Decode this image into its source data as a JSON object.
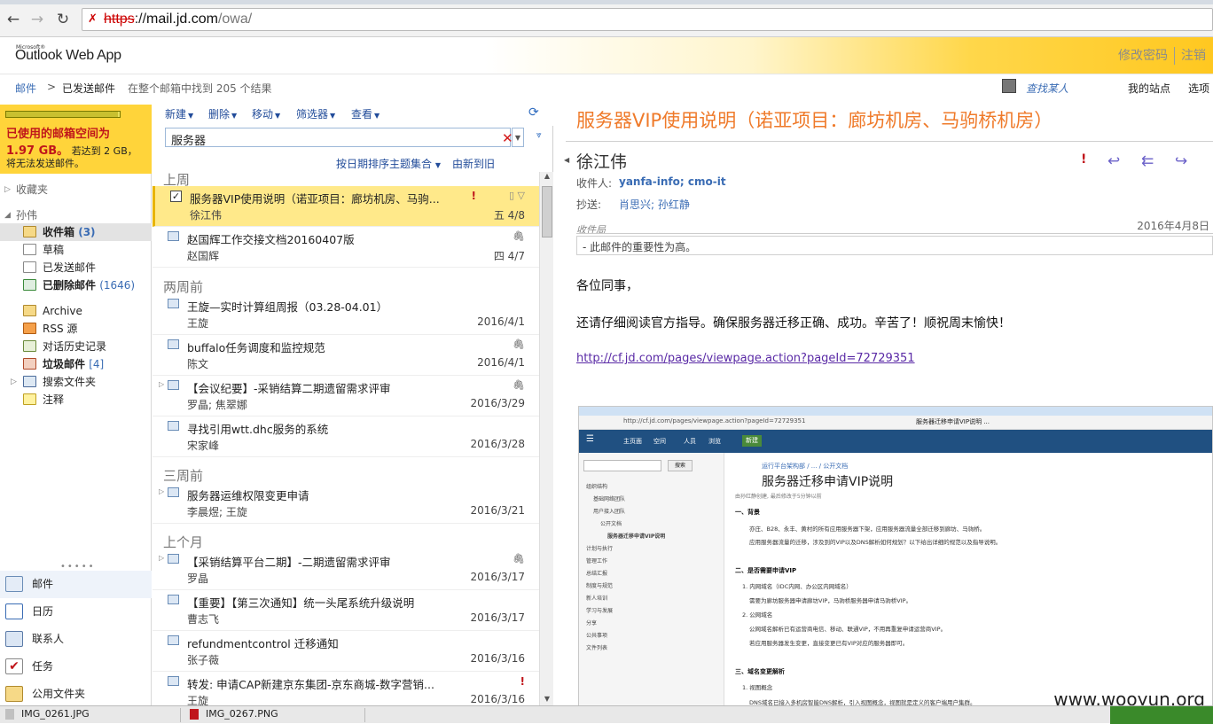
{
  "browser": {
    "url_scheme": "https",
    "url_host": "mail.jd.com",
    "url_path": "/owa/"
  },
  "header": {
    "logo_small": "Microsoft®",
    "logo": "Outlook Web App",
    "change_password": "修改密码",
    "logout": "注销"
  },
  "breadcrumb": {
    "mail": "邮件",
    "arrow": ">",
    "folder": "已发送邮件",
    "search_result": "在整个邮箱中找到 205 个结果",
    "find_people": "查找某人",
    "my_sites": "我的站点",
    "options": "选项"
  },
  "quota": {
    "line1": "已使用的邮箱空间为",
    "used": "1.97 GB。",
    "line2_rest": "若达到 2 GB，",
    "line3": "将无法发送邮件。",
    "fill": 0.985
  },
  "nav": {
    "favorites": "收藏夹",
    "user": "孙伟",
    "folders": [
      {
        "label": "收件箱",
        "count": "(3)"
      },
      {
        "label": "草稿",
        "count": ""
      },
      {
        "label": "已发送邮件",
        "count": ""
      },
      {
        "label": "已删除邮件",
        "count": "(1646)"
      },
      {
        "label": "Archive",
        "count": ""
      },
      {
        "label": "RSS 源",
        "count": ""
      },
      {
        "label": "对话历史记录",
        "count": ""
      },
      {
        "label": "垃圾邮件",
        "count": "[4]"
      },
      {
        "label": "搜索文件夹",
        "count": ""
      },
      {
        "label": "注释",
        "count": ""
      }
    ],
    "grip": "•••••",
    "modules": [
      {
        "label": "邮件",
        "icon": "mail-icon"
      },
      {
        "label": "日历",
        "icon": "calendar-icon"
      },
      {
        "label": "联系人",
        "icon": "contacts-icon"
      },
      {
        "label": "任务",
        "icon": "tasks-icon"
      },
      {
        "label": "公用文件夹",
        "icon": "public-folder-icon"
      }
    ]
  },
  "toolbar": {
    "new": "新建",
    "delete": "删除",
    "move": "移动",
    "filter": "筛选器",
    "view": "查看"
  },
  "search": {
    "value": "服务器",
    "sort": "按日期排序主题集合",
    "order": "由新到旧"
  },
  "groups": {
    "last_week": "上周",
    "two_weeks": "两周前",
    "three_weeks": "三周前",
    "last_month": "上个月"
  },
  "messages": [
    {
      "subject": "服务器VIP使用说明（诺亚项目：廊坊机房、马驹...",
      "from": "徐江伟",
      "date": "五 4/8"
    },
    {
      "subject": "赵国辉工作交接文档20160407版",
      "from": "赵国辉",
      "date": "四 4/7"
    },
    {
      "subject": "王旋—实时计算组周报（03.28-04.01）",
      "from": "王旋",
      "date": "2016/4/1"
    },
    {
      "subject": "buffalo任务调度和监控规范",
      "from": "陈文",
      "date": "2016/4/1"
    },
    {
      "subject": "【会议纪要】-采销结算二期遗留需求评审",
      "from": "罗晶; 焦翠娜",
      "date": "2016/3/29"
    },
    {
      "subject": "寻找引用wtt.dhc服务的系统",
      "from": "宋家峰",
      "date": "2016/3/28"
    },
    {
      "subject": "服务器运维权限变更申请",
      "from": "李晨煜; 王旋",
      "date": "2016/3/21"
    },
    {
      "subject": "【采销结算平台二期】-二期遗留需求评审",
      "from": "罗晶",
      "date": "2016/3/17"
    },
    {
      "subject": "【重要】【第三次通知】统一头尾系统升级说明",
      "from": "曹志飞",
      "date": "2016/3/17"
    },
    {
      "subject": "refundmentcontrol 迁移通知",
      "from": "张子薇",
      "date": "2016/3/16"
    },
    {
      "subject": "转发: 申请CAP新建京东集团-京东商城-数字营销...",
      "from": "王旋",
      "date": "2016/3/16"
    }
  ],
  "reading": {
    "subject": "服务器VIP使用说明（诺亚项目：廊坊机房、马驹桥机房）",
    "sender": "徐江伟",
    "to_label": "收件人:",
    "to": "yanfa-info; cmo-it",
    "cc_label": "抄送:",
    "cc": "肖思兴; 孙红静",
    "recv_label": "收件局",
    "date": "2016年4月8日",
    "importance_note": "- 此邮件的重要性为高。",
    "greeting": "各位同事，",
    "body": "还请仔细阅读官方指导。确保服务器迁移正确、成功。辛苦了！顺祝周末愉快！",
    "link": "http://cf.jd.com/pages/viewpage.action?pageId=72729351"
  },
  "embedded": {
    "url": "http://cf.jd.com/pages/viewpage.action?pageId=72729351",
    "tab": "服务器迁移申请VIP说明 ...",
    "nav": [
      "主页面",
      "空间",
      "人员",
      "浏览"
    ],
    "new": "新建",
    "search_btn": "搜索",
    "side": [
      "组织结构",
      "基础网络团队",
      "用户接入团队",
      "公开文档",
      "服务器迁移申请VIP说明",
      "计划与执行",
      "管理工作",
      "总结汇报",
      "制度与规范",
      "新人培训",
      "学习与发展",
      "分享",
      "公共事项",
      "文件列表"
    ],
    "breadcrumb": "运行平台架构部 / ... / 公开文档",
    "title": "服务器迁移申请VIP说明",
    "meta": "由孙红静创建, 最后修改于5分钟以前",
    "h1": "一、背景",
    "p1": "亦庄、B28、永丰、黄村的所有应用服务器下架，应用服务器流量全部迁移到廊坊、马驹桥。",
    "p2": "应用服务器流量的迁移，涉及到的VIP以及DNS解析如何规划？以下给出详细的规范以及指导说明。",
    "h2": "二、是否需要申请VIP",
    "p3": "1. 内网域名（IDC内网、办公区内网域名）",
    "p4": "需要为廊坊服务器申请廊坊VIP，马驹桥服务器申请马驹桥VIP。",
    "p5": "2. 公网域名",
    "p6": "公网域名解析已有运营商电信、移动、联通VIP，不用再重复申请运营商VIP。",
    "p7": "若应用服务器发生变更，直接变更已有VIP对应的服务器即可。",
    "h3": "三、域名变更解析",
    "p8": "1. 视图概念",
    "p9": "DNS域名已接入多机房智能DNS解析，引入视图概念，视图就是定义的客户端用户集群。"
  },
  "watermark": "www.wooyun.org",
  "downloads": [
    "IMG_0261.JPG",
    "IMG_0267.PNG"
  ]
}
